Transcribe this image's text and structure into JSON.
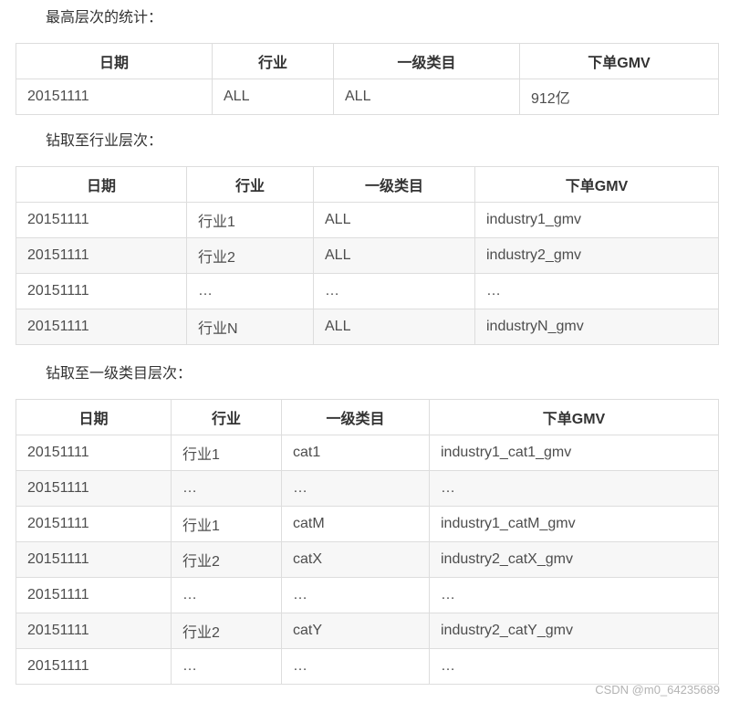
{
  "headers": [
    "日期",
    "行业",
    "一级类目",
    "下单GMV"
  ],
  "sections": [
    {
      "caption": "最高层次的统计：",
      "rows": [
        [
          "20151111",
          "ALL",
          "ALL",
          "912亿"
        ]
      ]
    },
    {
      "caption": "钻取至行业层次：",
      "rows": [
        [
          "20151111",
          "行业1",
          "ALL",
          "industry1_gmv"
        ],
        [
          "20151111",
          "行业2",
          "ALL",
          "industry2_gmv"
        ],
        [
          "20151111",
          "…",
          "…",
          "…"
        ],
        [
          "20151111",
          "行业N",
          "ALL",
          "industryN_gmv"
        ]
      ]
    },
    {
      "caption": "钻取至一级类目层次：",
      "rows": [
        [
          "20151111",
          "行业1",
          "cat1",
          "industry1_cat1_gmv"
        ],
        [
          "20151111",
          "…",
          "…",
          "…"
        ],
        [
          "20151111",
          "行业1",
          "catM",
          "industry1_catM_gmv"
        ],
        [
          "20151111",
          "行业2",
          "catX",
          "industry2_catX_gmv"
        ],
        [
          "20151111",
          "…",
          "…",
          "…"
        ],
        [
          "20151111",
          "行业2",
          "catY",
          "industry2_catY_gmv"
        ],
        [
          "20151111",
          "…",
          "…",
          "…"
        ]
      ]
    }
  ],
  "watermark": "CSDN @m0_64235689"
}
